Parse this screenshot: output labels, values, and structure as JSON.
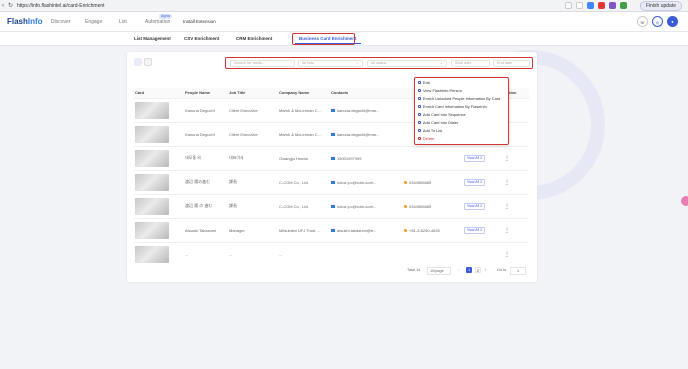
{
  "browser": {
    "url": "https://info.flashintel.ai/card-Enrichment",
    "update_label": "Finish update"
  },
  "app": {
    "logo_main": "Flash",
    "logo_accent": "Info",
    "nav": [
      "Discover",
      "Engage",
      "List",
      "Automation"
    ],
    "automation_badge": "Alpha",
    "install_extension": "Install Extension"
  },
  "subtabs": [
    "List Management",
    "CSV Enrichment",
    "CRM Enrichment",
    "Business Card Enrichment"
  ],
  "filters": {
    "search_placeholder": "Search for cards...",
    "all_lists": "All lists",
    "all_status": "All status",
    "start_date": "Start date",
    "end_date": "End date"
  },
  "table": {
    "headers": [
      "Card",
      "People Name",
      "Job Title",
      "Company Name",
      "Contacts",
      "",
      "",
      "Action"
    ],
    "view_all_label": "View All 2",
    "rows": [
      {
        "name": "Kanuna Deguchi",
        "title": "Client Executive",
        "company": "Marsh & McLennan C...",
        "email": "kanuna.deguchi@mar...",
        "phone": "",
        "view": true
      },
      {
        "name": "Kanuna Deguchi",
        "title": "Client Executive",
        "company": "Marsh & McLennan C...",
        "email": "kanuna.deguchi@mar...",
        "phone": "",
        "view": true
      },
      {
        "name": "데모홍 외",
        "title": "대표이사",
        "company": "Gwangju Honda",
        "email": "15001997399",
        "phone": "",
        "view": true
      },
      {
        "name": "渡辺 陽の進む",
        "title": "課長",
        "company": "C-COM Co., Ltd.",
        "email": "kotoz.y.c@cdm-com...",
        "phone": "0344566689",
        "view": true
      },
      {
        "name": "渡辺 陽 の 進む",
        "title": "課長",
        "company": "C-COM Co., Ltd.",
        "email": "kotoz.y.c@cdm-com...",
        "phone": "0344566689",
        "view": true
      },
      {
        "name": "Atsushi Takasumi",
        "title": "Manager",
        "company": "Mitsubishi UFJ Trust ...",
        "email": "atsushi.takasumi@tr...",
        "phone": "+81-3-6250-4630",
        "view": true
      },
      {
        "name": "...",
        "title": "...",
        "company": "...",
        "email": "",
        "phone": "",
        "view": false
      }
    ]
  },
  "pagination": {
    "total": "Total 14",
    "page_size": "10/page",
    "pages": [
      "1",
      "2"
    ],
    "goto": "Go to",
    "goto_value": "1"
  },
  "row_menu": {
    "items": [
      "Edit",
      "View FlashInfo Person",
      "Enrich Unlocked People Information By Card",
      "Enrich Card Information By FlashInfo",
      "Add Card Into Sequence",
      "Add Card Into Dialer",
      "Add To List",
      "Delete"
    ]
  },
  "colors": {
    "accent": "#3a5ad6",
    "highlight": "#d23535"
  }
}
